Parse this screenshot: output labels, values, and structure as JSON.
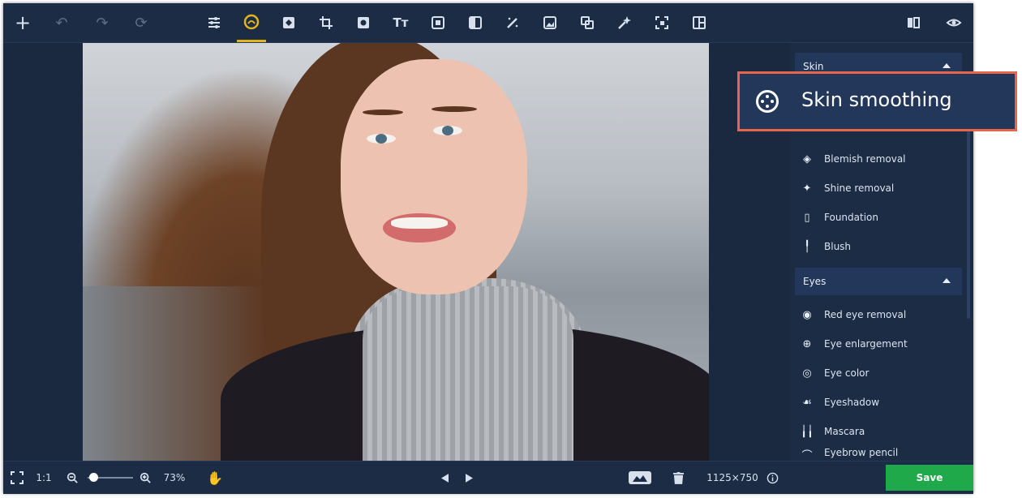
{
  "toolbar": {
    "left": [
      {
        "name": "add-icon",
        "glyph": "+"
      },
      {
        "name": "undo-icon",
        "glyph": "↶"
      },
      {
        "name": "redo-icon",
        "glyph": "↷"
      },
      {
        "name": "reset-icon",
        "glyph": "⟳"
      }
    ],
    "tools": [
      "adjust-icon",
      "retouch-icon",
      "enhance-icon",
      "crop-icon",
      "effects-icon",
      "text-icon",
      "frame-icon",
      "filter-icon",
      "magic-icon",
      "insert-image-icon",
      "object-removal-icon",
      "sticker-icon",
      "resize-icon",
      "layout-icon"
    ],
    "right": [
      "compare-icon",
      "preview-icon"
    ],
    "active_tool": "retouch-icon",
    "accent": "#e3b31d"
  },
  "panel": {
    "skin_header": "Skin",
    "skin_items": [
      {
        "label": "Blemish removal",
        "icon": "blemish-icon"
      },
      {
        "label": "Shine removal",
        "icon": "sparkle-icon"
      },
      {
        "label": "Foundation",
        "icon": "foundation-icon"
      },
      {
        "label": "Blush",
        "icon": "brush-icon"
      }
    ],
    "eyes_header": "Eyes",
    "eyes_items": [
      {
        "label": "Red eye removal",
        "icon": "eye-icon"
      },
      {
        "label": "Eye enlargement",
        "icon": "eye-enlarge-icon"
      },
      {
        "label": "Eye color",
        "icon": "eye-color-icon"
      },
      {
        "label": "Eyeshadow",
        "icon": "eyeshadow-icon"
      },
      {
        "label": "Mascara",
        "icon": "mascara-icon"
      },
      {
        "label": "Eyebrow pencil",
        "icon": "eyebrow-icon"
      }
    ]
  },
  "callout": {
    "label": "Skin smoothing",
    "icon": "skin-smoothing-icon",
    "border_color": "#e6664a"
  },
  "bottom": {
    "fit_label": "1:1",
    "zoom_value": "73%",
    "dimensions": "1125×750",
    "save_label": "Save",
    "save_color": "#1fa94a"
  }
}
